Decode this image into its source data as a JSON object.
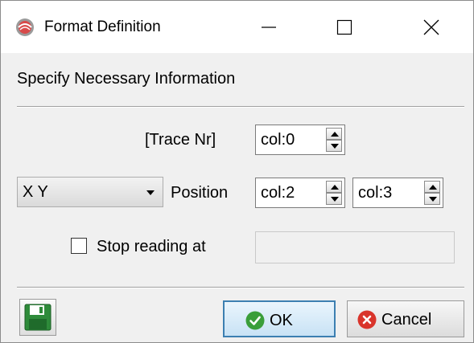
{
  "window": {
    "title": "Format Definition",
    "controls": [
      "minimize",
      "maximize",
      "close"
    ]
  },
  "header": {
    "text": "Specify Necessary Information"
  },
  "trace": {
    "label": "[Trace Nr]",
    "value": "col:0"
  },
  "position": {
    "type_selected": "X Y",
    "label": "Position",
    "x_value": "col:2",
    "y_value": "col:3"
  },
  "stop_reading": {
    "label": "Stop reading at",
    "checked": false,
    "value": ""
  },
  "footer": {
    "ok_label": "OK",
    "cancel_label": "Cancel"
  },
  "icons": {
    "app": "app-icon",
    "save": "floppy-disk-icon",
    "ok": "check-icon",
    "cancel": "x-circle-icon"
  },
  "colors": {
    "ok_icon": "#3a9e3a",
    "cancel_icon": "#d9342b",
    "save_icon": "#2e8b3a",
    "focus_border": "#3c7fb1"
  }
}
